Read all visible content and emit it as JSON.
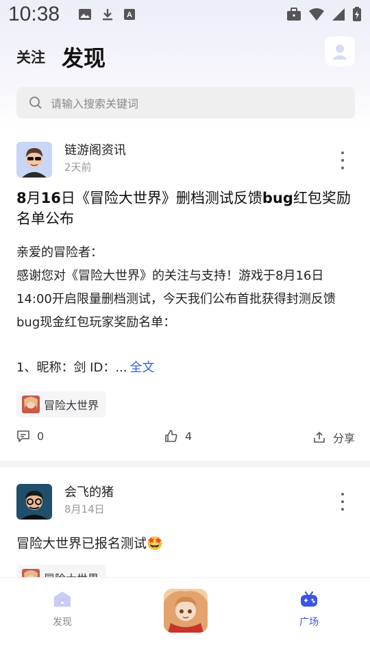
{
  "status": {
    "time": "10:38"
  },
  "header": {
    "tab_follow": "关注",
    "tab_discover": "发现"
  },
  "search": {
    "placeholder": "请输入搜索关键词"
  },
  "posts": [
    {
      "author": "链游阁资讯",
      "time": "2天前",
      "title_parts": [
        "8",
        "月",
        "16",
        "日《冒险大世界》删档测试反馈",
        "bug",
        "红包奖励名单公布"
      ],
      "body": "亲爱的冒险者：\n感谢您对《冒险大世界》的关注与支持！游戏于8月16日14:00开启限量删档测试，今天我们公布首批获得封测反馈bug现金红包玩家奖励名单：",
      "more_text": "1、昵称：剑   ID：...",
      "fulltext_label": "全文",
      "tag": "冒险大世界",
      "comments": "0",
      "likes": "4",
      "share_label": "分享"
    },
    {
      "author": "会飞的猪",
      "time": "8月14日",
      "text": "冒险大世界已报名测试🤩",
      "tag": "冒险大世界"
    }
  ],
  "nav": {
    "discover": "发现",
    "plaza": "广场"
  },
  "colors": {
    "accent": "#2c64e8",
    "nav_active": "#3b55e6",
    "nav_inactive": "#c9ccf4"
  }
}
